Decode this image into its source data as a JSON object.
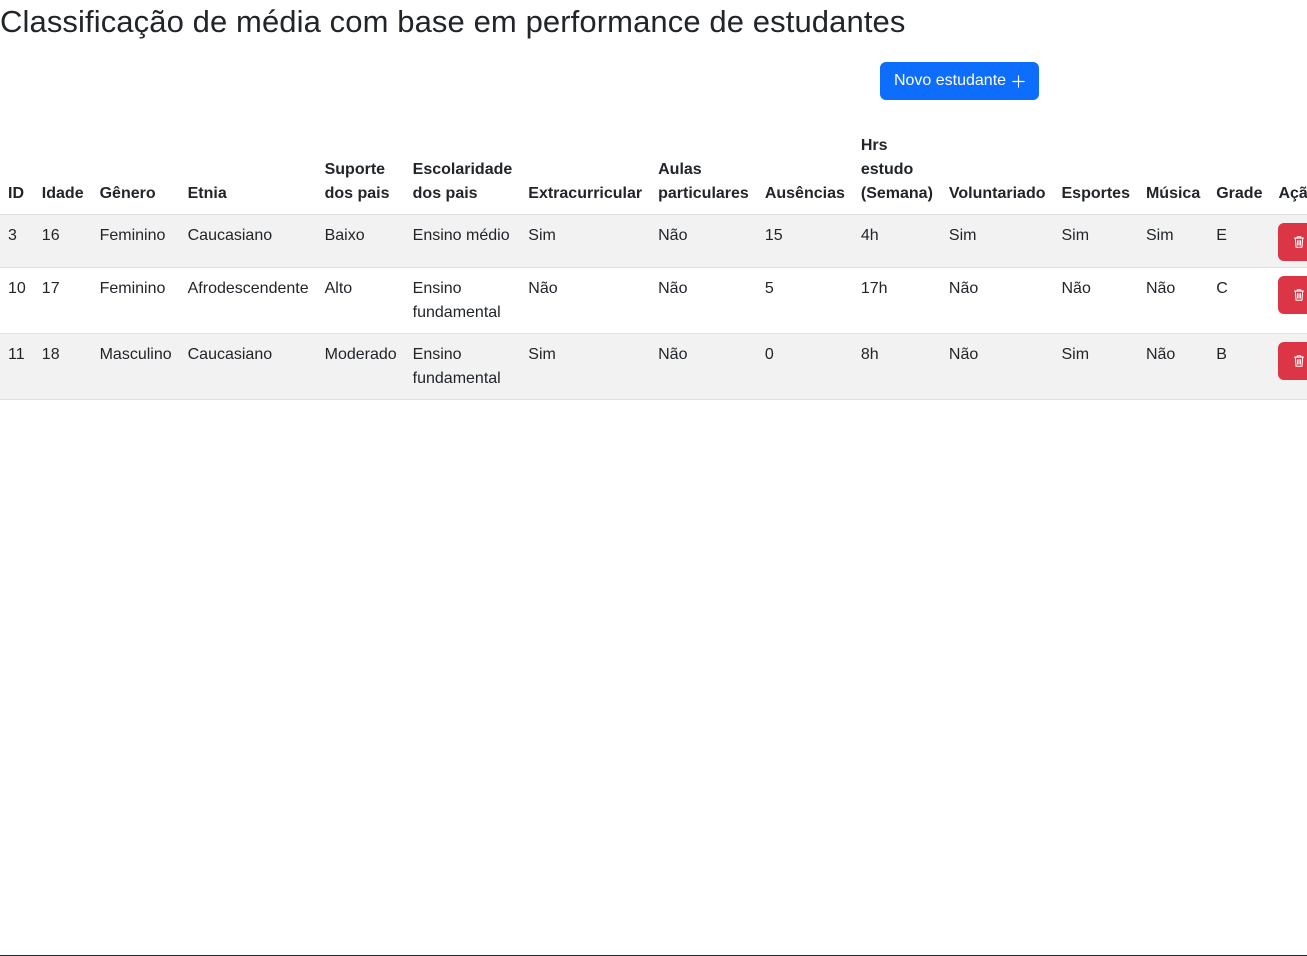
{
  "page": {
    "title": "Classificação de média com base em performance de estudantes"
  },
  "toolbar": {
    "new_student_label": "Novo estudante",
    "new_student_icon": "plus-icon"
  },
  "table": {
    "headers": {
      "id": "ID",
      "idade": "Idade",
      "genero": "Gênero",
      "etnia": "Etnia",
      "suporte_pais": "Suporte dos pais",
      "escolaridade_pais": "Escolaridade dos pais",
      "extracurricular": "Extracurricular",
      "aulas_particulares": "Aulas particulares",
      "ausencias": "Ausências",
      "hrs_estudo": "Hrs estudo (Semana)",
      "voluntariado": "Voluntariado",
      "esportes": "Esportes",
      "musica": "Música",
      "grade": "Grade",
      "acao": "Ação"
    },
    "rows": [
      {
        "id": "3",
        "idade": "16",
        "genero": "Feminino",
        "etnia": "Caucasiano",
        "suporte_pais": "Baixo",
        "escolaridade_pais": "Ensino médio",
        "extracurricular": "Sim",
        "aulas_particulares": "Não",
        "ausencias": "15",
        "hrs_estudo": "4h",
        "voluntariado": "Sim",
        "esportes": "Sim",
        "musica": "Sim",
        "grade": "E"
      },
      {
        "id": "10",
        "idade": "17",
        "genero": "Feminino",
        "etnia": "Afrodescendente",
        "suporte_pais": "Alto",
        "escolaridade_pais": "Ensino fundamental",
        "extracurricular": "Não",
        "aulas_particulares": "Não",
        "ausencias": "5",
        "hrs_estudo": "17h",
        "voluntariado": "Não",
        "esportes": "Não",
        "musica": "Não",
        "grade": "C"
      },
      {
        "id": "11",
        "idade": "18",
        "genero": "Masculino",
        "etnia": "Caucasiano",
        "suporte_pais": "Moderado",
        "escolaridade_pais": "Ensino fundamental",
        "extracurricular": "Sim",
        "aulas_particulares": "Não",
        "ausencias": "0",
        "hrs_estudo": "8h",
        "voluntariado": "Não",
        "esportes": "Sim",
        "musica": "Não",
        "grade": "B"
      }
    ],
    "delete_icon": "trash-icon"
  },
  "colors": {
    "primary": "#0d6efd",
    "danger": "#dc3545",
    "striped_row": "#f2f2f2",
    "border": "#dee2e6",
    "text": "#212529"
  }
}
